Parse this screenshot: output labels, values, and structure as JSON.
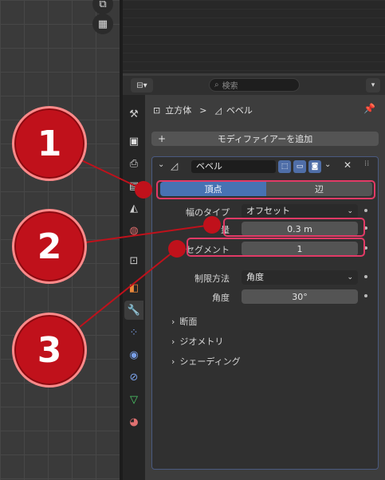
{
  "properties_header": {
    "search_placeholder": "検索",
    "editor_icon": "properties-editor-icon"
  },
  "breadcrumb": {
    "object_name": "立方体",
    "separator": ">",
    "modifier_name": "ベベル"
  },
  "add_modifier_label": "モディファイアーを追加",
  "modifier": {
    "name": "ベベル",
    "affect_options": [
      "頂点",
      "辺"
    ],
    "affect_selected": "頂点",
    "width_type_label": "幅のタイプ",
    "width_type_value": "オフセット",
    "amount_label": "量",
    "amount_value": "0.3 m",
    "segments_label": "セグメント",
    "segments_value": "1",
    "limit_method_label": "制限方法",
    "limit_method_value": "角度",
    "angle_label": "角度",
    "angle_value": "30°",
    "subpanels": [
      "断面",
      "ジオメトリ",
      "シェーディング"
    ]
  },
  "callouts": [
    "1",
    "2",
    "3"
  ],
  "colors": {
    "accent": "#4772b3",
    "highlight": "#e23a66",
    "callout": "#c0111b"
  }
}
